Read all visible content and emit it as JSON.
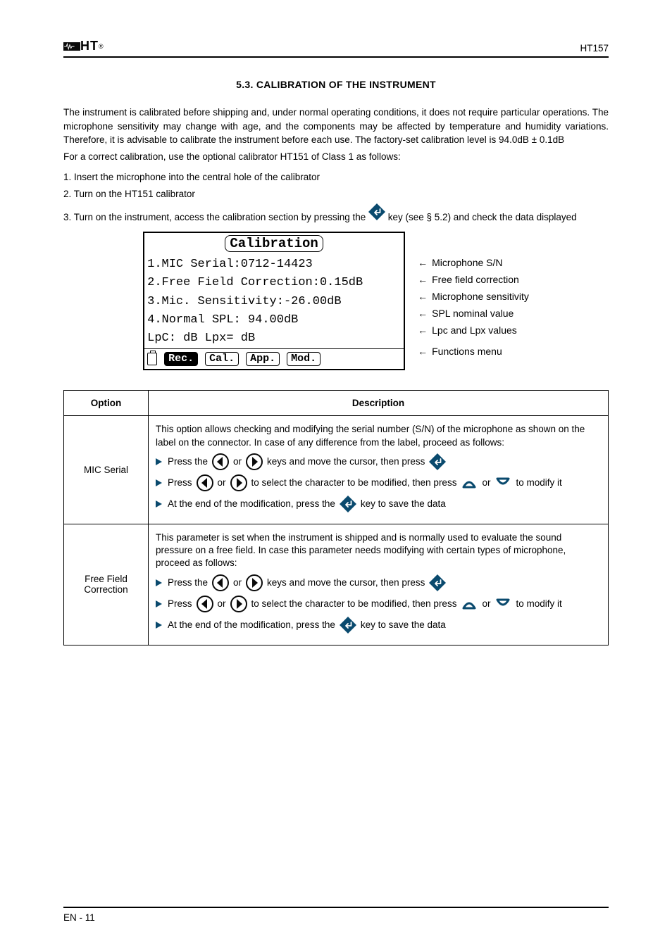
{
  "header": {
    "brand_prefix": "",
    "brand": "HT",
    "model": "HT157"
  },
  "heading": "5.3. CALIBRATION OF THE INSTRUMENT",
  "intro": {
    "p1": "The instrument is calibrated before shipping and, under normal operating conditions, it does not require particular operations. The microphone sensitivity may change with age, and the components may be affected by temperature and humidity variations. Therefore, it is advisable to calibrate the instrument before each use. The factory-set calibration level is 94.0dB",
    "p1_value": "0.1dB",
    "p2": "For a correct calibration, use the optional calibrator HT151 of Class 1 as follows:",
    "steps": [
      "1. Insert the microphone into the central hole of the calibrator",
      "2. Turn on the HT151 calibrator",
      "3. Turn on the instrument, access the calibration section by pressing the",
      "key (see § 5.2) and check the data displayed"
    ]
  },
  "lcd": {
    "title": "Calibration",
    "line1": "1.MIC Serial:0712-14423",
    "line2": "2.Free Field Correction:0.15dB",
    "line3": "3.Mic. Sensitivity:-26.00dB",
    "line4": "4.Normal SPL: 94.00dB",
    "line5": "LpC:      dB Lpx=     dB",
    "buttons": [
      "Rec.",
      "Cal.",
      "App.",
      "Mod."
    ]
  },
  "legend": {
    "l1": "Microphone S/N",
    "l2": "Free field correction",
    "l3": "Microphone sensitivity",
    "l4": "SPL nominal value",
    "l5": "Lpc and Lpx values",
    "l6": "Functions menu"
  },
  "table": {
    "col1": "Option",
    "col2": "Description",
    "rows": [
      {
        "label": "MIC Serial",
        "desc_intro": "This option allows checking and modifying the serial number (S/N) of the microphone as shown on the label on the connector. In case of any difference from the label, proceed as follows:",
        "bullets": [
          {
            "pre": "Press the",
            "mid": "or",
            "post": "keys and move the cursor, then press"
          },
          {
            "pre": "Press",
            "mid": "or",
            "post": "to select the character to be modified, then press",
            "or2": "or",
            "post2": "to modify it"
          },
          {
            "pre": "At the end of the modification, press the",
            "post": "key to save the data"
          }
        ]
      },
      {
        "label": "Free Field Correction",
        "desc_intro": "This parameter is set when the instrument is shipped and is normally used to evaluate the sound pressure on a free field. In case this parameter needs modifying with certain types of microphone, proceed as follows:",
        "bullets": [
          {
            "pre": "Press the",
            "mid": "or",
            "post": "keys and move the cursor, then press"
          },
          {
            "pre": "Press",
            "mid": "or",
            "post": "to select the character to be modified, then press",
            "or2": "or",
            "post2": "to modify it"
          },
          {
            "pre": "At the end of the modification, press the",
            "post": "key to save the data"
          }
        ]
      }
    ]
  },
  "footer": {
    "left": "EN - 11",
    "right": ""
  }
}
